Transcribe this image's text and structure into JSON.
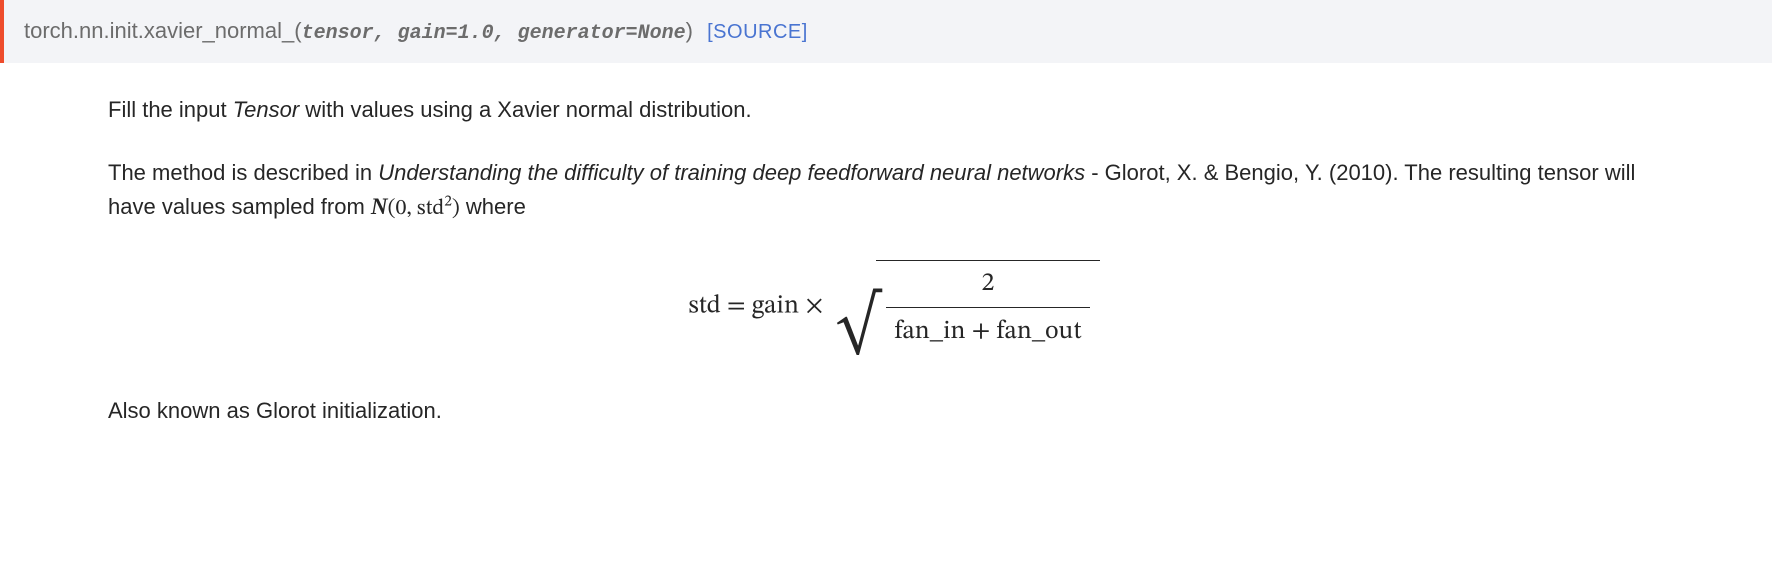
{
  "signature": {
    "qualifier": "torch.nn.init.",
    "name": "xavier_normal_",
    "open": "(",
    "params": [
      "tensor",
      "gain=1.0",
      "generator=None"
    ],
    "sep": ", ",
    "close": ")",
    "source_label": "[SOURCE]"
  },
  "body": {
    "p1_pre": "Fill the input ",
    "p1_em": "Tensor",
    "p1_post": " with values using a Xavier normal distribution.",
    "p2_pre": "The method is described in ",
    "p2_em": "Understanding the difficulty of training deep feedforward neural networks",
    "p2_mid": " - Glorot, X. & Bengio, Y. (2010). The resulting tensor will have values sampled from ",
    "p2_math_open": "(0, ",
    "p2_math_std": "std",
    "p2_math_exp": "2",
    "p2_math_close": ")",
    "p2_post": " where",
    "formula": {
      "lhs": "std = gain × ",
      "numerator": "2",
      "denominator": "fan_in + fan_out"
    },
    "p3": "Also known as Glorot initialization."
  }
}
